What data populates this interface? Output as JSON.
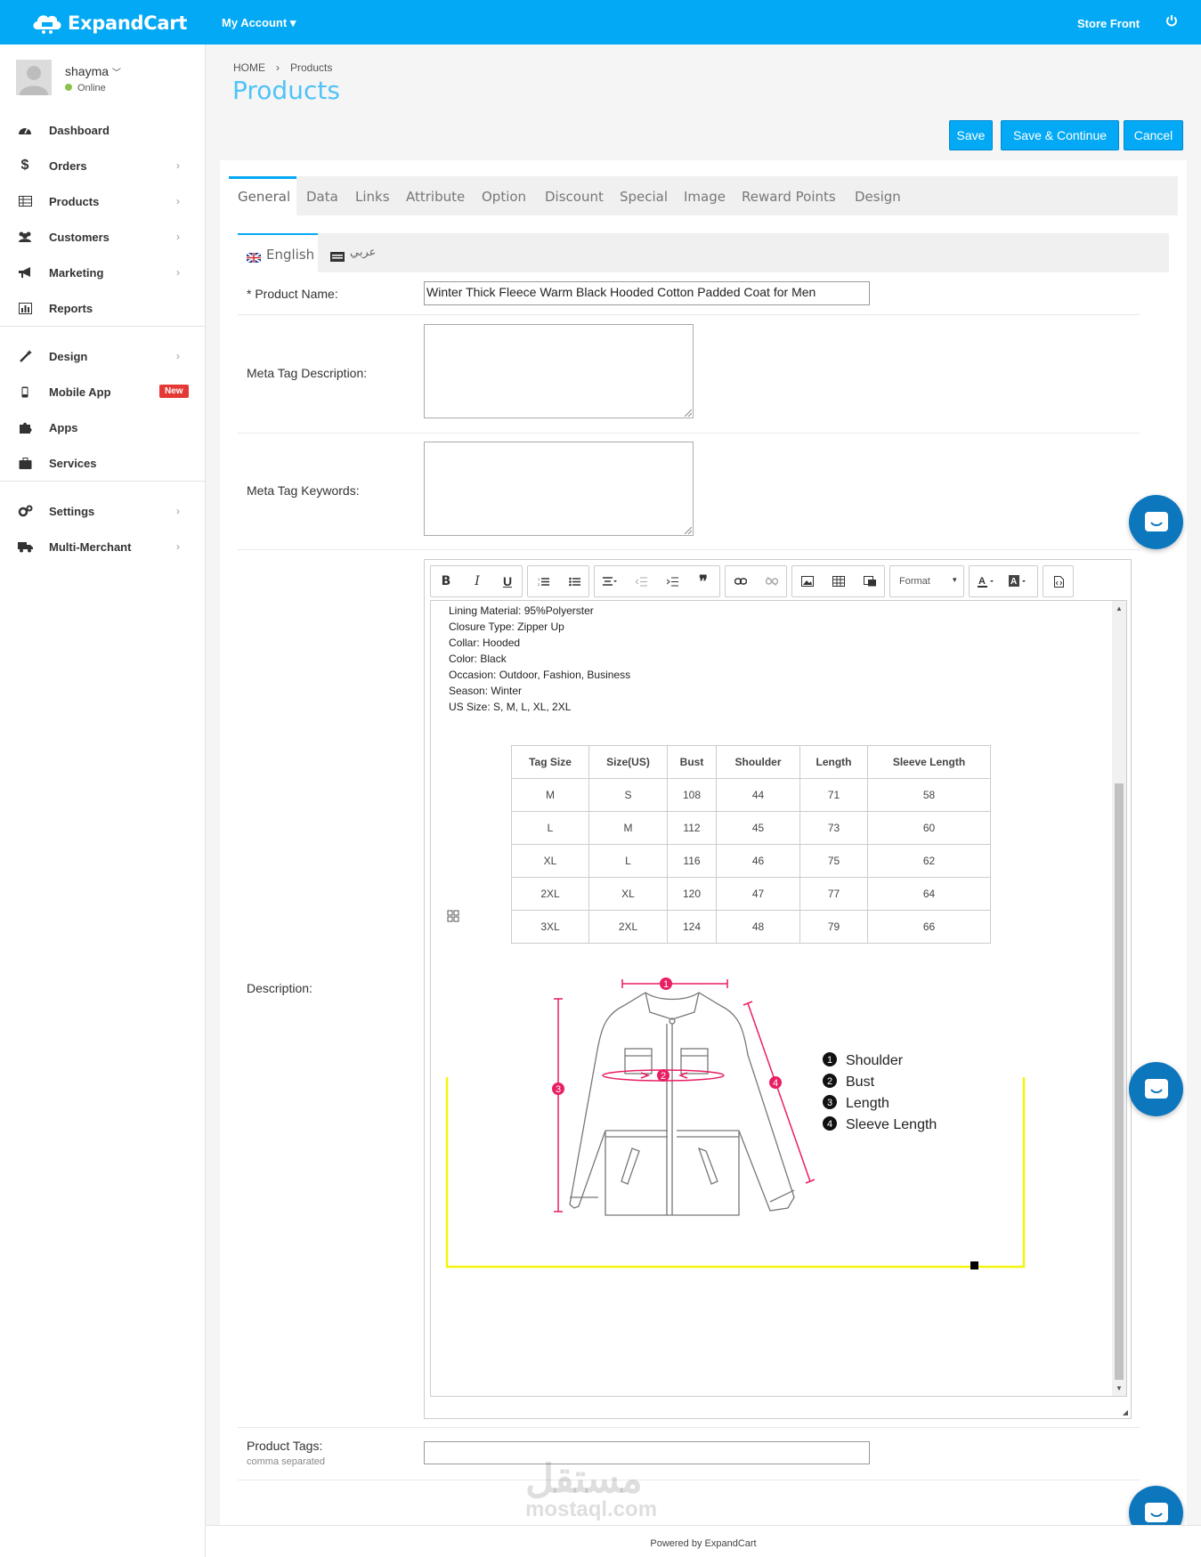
{
  "app": {
    "logo_text": "ExpandCart",
    "my_account": "My Account",
    "store_front": "Store Front"
  },
  "user": {
    "name": "shayma",
    "status": "Online"
  },
  "sidebar": {
    "items": [
      {
        "label": "Dashboard",
        "icon": "dashboard-icon"
      },
      {
        "label": "Orders",
        "icon": "dollar-icon"
      },
      {
        "label": "Products",
        "icon": "table-icon"
      },
      {
        "label": "Customers",
        "icon": "users-icon"
      },
      {
        "label": "Marketing",
        "icon": "bullhorn-icon"
      },
      {
        "label": "Reports",
        "icon": "bar-chart-icon"
      },
      {
        "label": "Design",
        "icon": "magic-wand-icon"
      },
      {
        "label": "Mobile App",
        "icon": "mobile-icon",
        "badge": "New"
      },
      {
        "label": "Apps",
        "icon": "puzzle-icon"
      },
      {
        "label": "Services",
        "icon": "briefcase-icon"
      },
      {
        "label": "Settings",
        "icon": "gears-icon"
      },
      {
        "label": "Multi-Merchant",
        "icon": "truck-icon"
      }
    ]
  },
  "breadcrumb": {
    "home": "HOME",
    "current": "Products"
  },
  "page_title": "Products",
  "actions": {
    "save": "Save",
    "save_continue": "Save & Continue",
    "cancel": "Cancel"
  },
  "tabs": [
    "General",
    "Data",
    "Links",
    "Attribute",
    "Option",
    "Discount",
    "Special",
    "Image",
    "Reward Points",
    "Design"
  ],
  "lang_tabs": [
    "English",
    "عربي"
  ],
  "form": {
    "product_name_label": "* Product Name:",
    "product_name_value": "Winter Thick Fleece Warm Black Hooded Cotton Padded Coat for Men",
    "meta_desc_label": "Meta Tag Description:",
    "meta_keywords_label": "Meta Tag Keywords:",
    "description_label": "Description:",
    "tags_label": "Product Tags:",
    "tags_hint": "comma separated"
  },
  "editor": {
    "format_label": "Format",
    "lines": [
      "Lining Material: 95%Polyerster",
      "Closure Type: Zipper Up",
      "Collar: Hooded",
      "Color: Black",
      "Occasion: Outdoor, Fashion, Business",
      "Season: Winter",
      "US Size: S, M, L, XL, 2XL"
    ],
    "table_headers": [
      "Tag Size",
      "Size(US)",
      "Bust",
      "Shoulder",
      "Length",
      "Sleeve Length"
    ],
    "table_rows": [
      [
        "M",
        "S",
        "108",
        "44",
        "71",
        "58"
      ],
      [
        "L",
        "M",
        "112",
        "45",
        "73",
        "60"
      ],
      [
        "XL",
        "L",
        "116",
        "46",
        "75",
        "62"
      ],
      [
        "2XL",
        "XL",
        "120",
        "47",
        "77",
        "64"
      ],
      [
        "3XL",
        "2XL",
        "124",
        "48",
        "79",
        "66"
      ]
    ],
    "legend": [
      {
        "num": "1",
        "label": "Shoulder"
      },
      {
        "num": "2",
        "label": "Bust"
      },
      {
        "num": "3",
        "label": "Length"
      },
      {
        "num": "4",
        "label": "Sleeve Length"
      }
    ]
  },
  "footer": "Powered by ExpandCart",
  "watermark": {
    "arabic": "مستقل",
    "latin": "mostaql.com"
  },
  "colors": {
    "brand": "#03a9f4",
    "title": "#4fc3f7",
    "badge": "#e53935",
    "chat": "#0d77bd",
    "measure": "#e91e63",
    "highlight": "#f4f40c"
  }
}
